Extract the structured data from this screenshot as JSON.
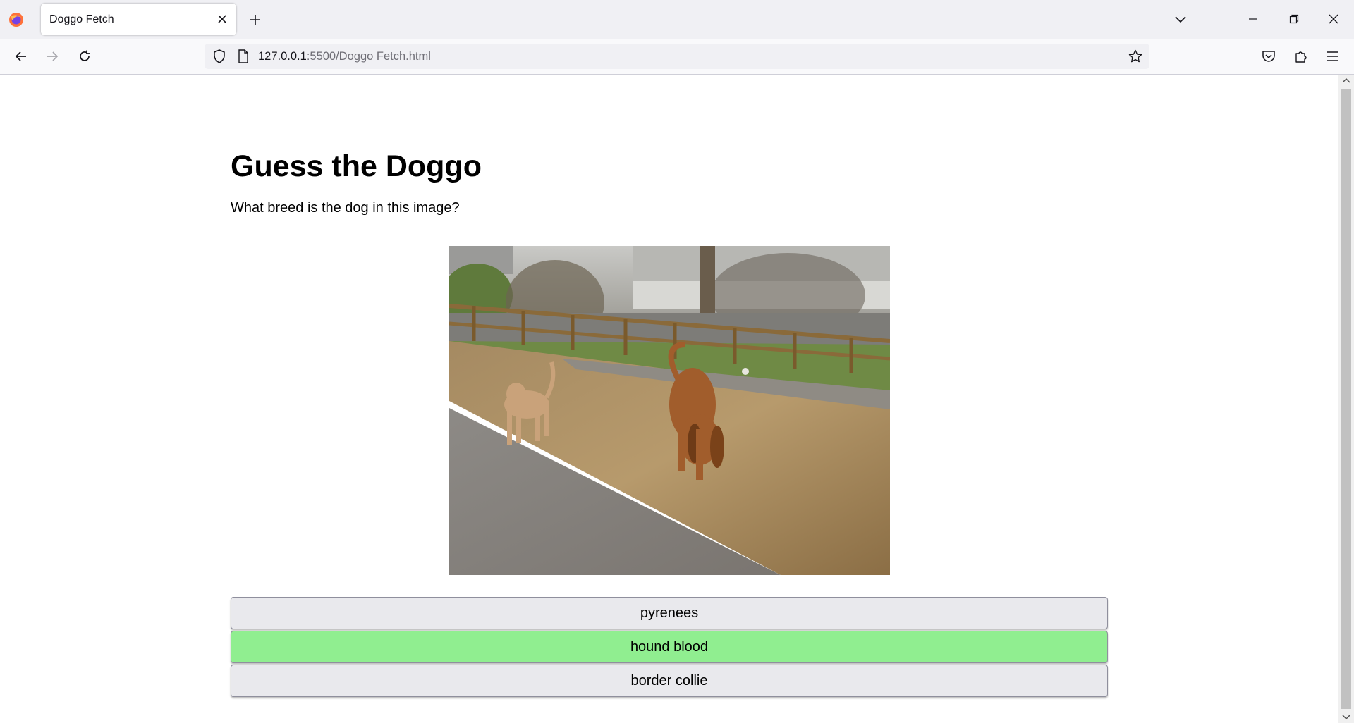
{
  "browser": {
    "tab_title": "Doggo Fetch",
    "url_host": "127.0.0.1",
    "url_rest": ":5500/Doggo Fetch.html"
  },
  "page": {
    "title": "Guess the Doggo",
    "question": "What breed is the dog in this image?",
    "answers": [
      {
        "label": "pyrenees",
        "state": "default"
      },
      {
        "label": "hound blood",
        "state": "correct"
      },
      {
        "label": "border collie",
        "state": "default"
      }
    ],
    "correct_color": "#90ee90",
    "button_color": "#e9e9ed"
  },
  "icons": {
    "browser_logo": "firefox-logo-icon",
    "tab_close": "close-icon",
    "new_tab": "plus-icon",
    "tab_list": "chevron-down-icon",
    "back": "arrow-left-icon",
    "forward": "arrow-right-icon",
    "reload": "reload-icon",
    "tracking": "shield-icon",
    "page": "page-icon",
    "bookmark": "star-icon",
    "pocket": "pocket-icon",
    "extensions": "puzzle-icon",
    "menu": "hamburger-icon"
  }
}
